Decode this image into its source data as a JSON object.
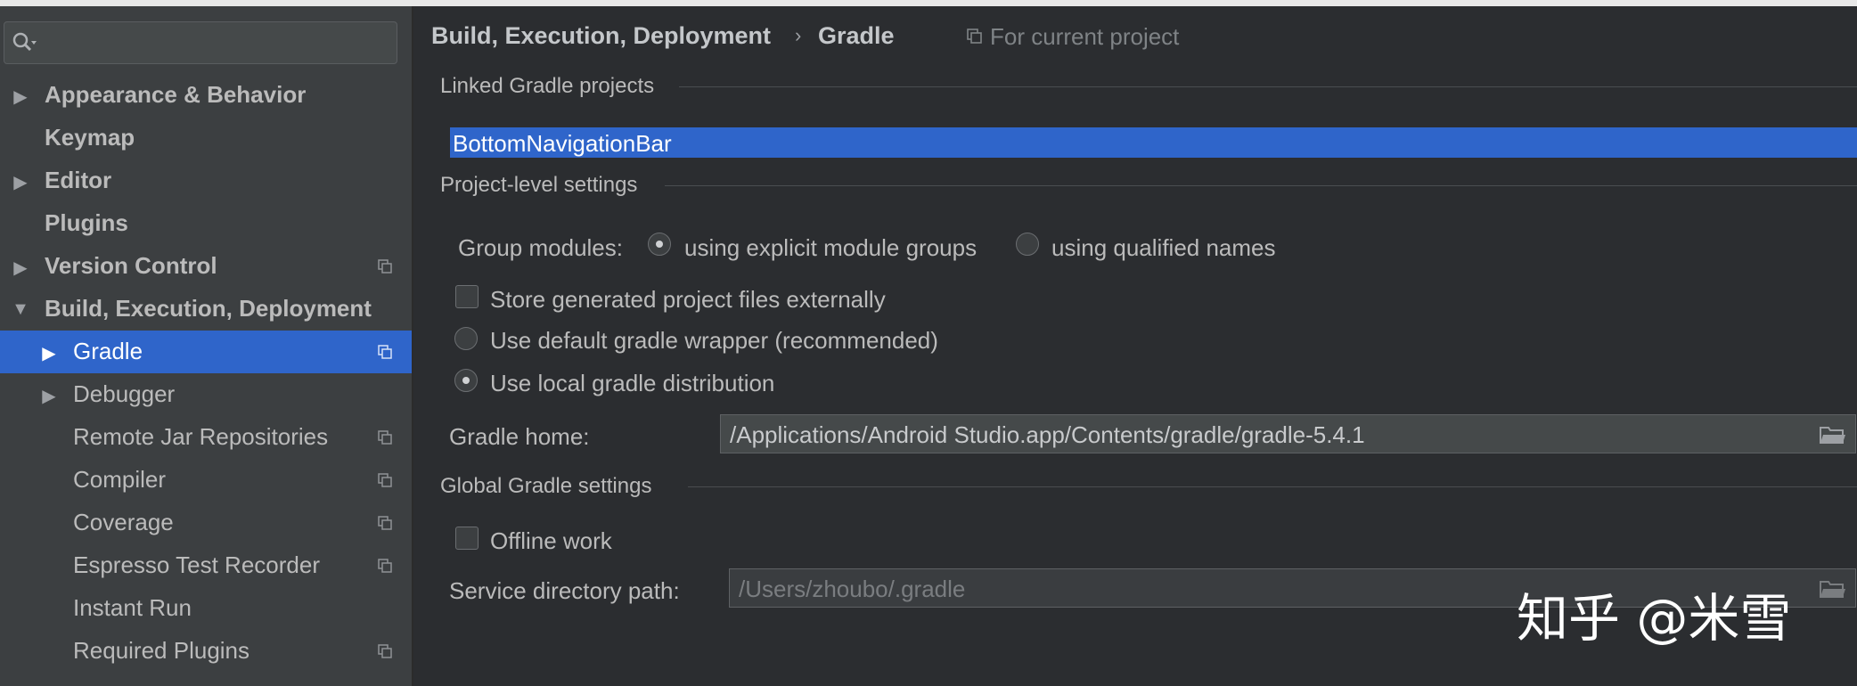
{
  "sidebar": {
    "items": [
      {
        "label": "Appearance & Behavior",
        "arrow": "▶",
        "indent": "top",
        "bold": true,
        "project_icon": false,
        "selected": false
      },
      {
        "label": "Keymap",
        "arrow": "",
        "indent": "top",
        "bold": true,
        "project_icon": false,
        "selected": false
      },
      {
        "label": "Editor",
        "arrow": "▶",
        "indent": "top",
        "bold": true,
        "project_icon": false,
        "selected": false
      },
      {
        "label": "Plugins",
        "arrow": "",
        "indent": "top",
        "bold": true,
        "project_icon": false,
        "selected": false
      },
      {
        "label": "Version Control",
        "arrow": "▶",
        "indent": "top",
        "bold": true,
        "project_icon": true,
        "selected": false
      },
      {
        "label": "Build, Execution, Deployment",
        "arrow": "▼",
        "indent": "top",
        "bold": true,
        "project_icon": false,
        "selected": false
      },
      {
        "label": "Gradle",
        "arrow": "▶",
        "indent": "child",
        "bold": false,
        "project_icon": true,
        "selected": true
      },
      {
        "label": "Debugger",
        "arrow": "▶",
        "indent": "child",
        "bold": false,
        "project_icon": false,
        "selected": false
      },
      {
        "label": "Remote Jar Repositories",
        "arrow": "",
        "indent": "child",
        "bold": false,
        "project_icon": true,
        "selected": false
      },
      {
        "label": "Compiler",
        "arrow": "",
        "indent": "child",
        "bold": false,
        "project_icon": true,
        "selected": false
      },
      {
        "label": "Coverage",
        "arrow": "",
        "indent": "child",
        "bold": false,
        "project_icon": true,
        "selected": false
      },
      {
        "label": "Espresso Test Recorder",
        "arrow": "",
        "indent": "child",
        "bold": false,
        "project_icon": true,
        "selected": false
      },
      {
        "label": "Instant Run",
        "arrow": "",
        "indent": "child",
        "bold": false,
        "project_icon": false,
        "selected": false
      },
      {
        "label": "Required Plugins",
        "arrow": "",
        "indent": "child",
        "bold": false,
        "project_icon": true,
        "selected": false
      }
    ],
    "search": {
      "value": "",
      "icon": "search-icon"
    }
  },
  "breadcrumb": {
    "parent": "Build, Execution, Deployment",
    "separator": "›",
    "current": "Gradle",
    "scope_hint": "For current project"
  },
  "linked": {
    "title": "Linked Gradle projects",
    "project": "BottomNavigationBar"
  },
  "project_settings": {
    "title": "Project-level settings",
    "group_modules_label": "Group modules:",
    "option_explicit": "using explicit module groups",
    "option_qualified": "using qualified names",
    "store_externally": "Store generated project files externally",
    "default_wrapper": "Use default gradle wrapper (recommended)",
    "local_distribution": "Use local gradle distribution",
    "gradle_home_label": "Gradle home:",
    "gradle_home_value": "/Applications/Android Studio.app/Contents/gradle/gradle-5.4.1"
  },
  "global_settings": {
    "title": "Global Gradle settings",
    "offline_work": "Offline work",
    "service_dir_label": "Service directory path:",
    "service_dir_value": "/Users/zhoubo/.gradle"
  },
  "watermark": "知乎 @米雪",
  "colors": {
    "accent": "#2f65ca",
    "sidebar_bg": "#3c3f41",
    "main_bg": "#2b2d30"
  }
}
